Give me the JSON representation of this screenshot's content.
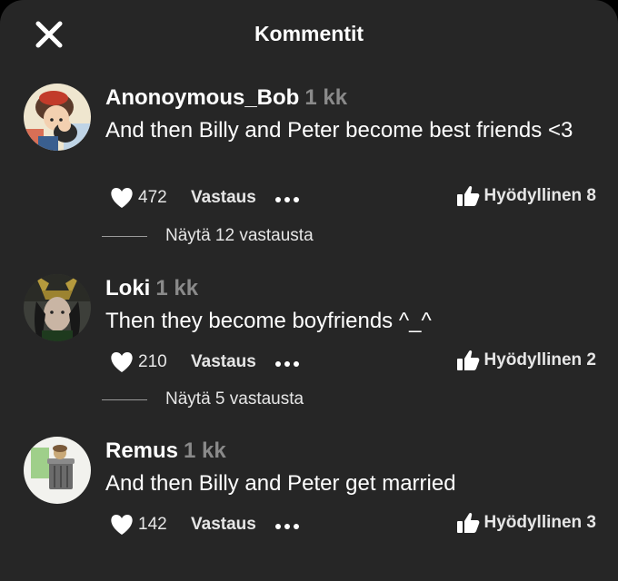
{
  "header": {
    "title": "Kommentit",
    "close_icon": "close-icon"
  },
  "comments": [
    {
      "author": "Anonoymous_Bob",
      "time": "1 kk",
      "text": "And then Billy and Peter become best friends <3",
      "likes": "472",
      "reply_label": "Vastaus",
      "helpful_label": "Hyödyllinen 8",
      "replies_link": "Näytä 12 vastausta"
    },
    {
      "author": "Loki",
      "time": "1 kk",
      "text": "Then they become boyfriends ^_^",
      "likes": "210",
      "reply_label": "Vastaus",
      "helpful_label": "Hyödyllinen 2",
      "replies_link": "Näytä 5 vastausta"
    },
    {
      "author": "Remus",
      "time": "1 kk",
      "text": "And then Billy and Peter get married",
      "likes": "142",
      "reply_label": "Vastaus",
      "helpful_label": "Hyödyllinen 3"
    }
  ],
  "icons": {
    "like": "heart-icon",
    "more": "more-dots-icon",
    "helpful": "thumbs-up-icon"
  }
}
